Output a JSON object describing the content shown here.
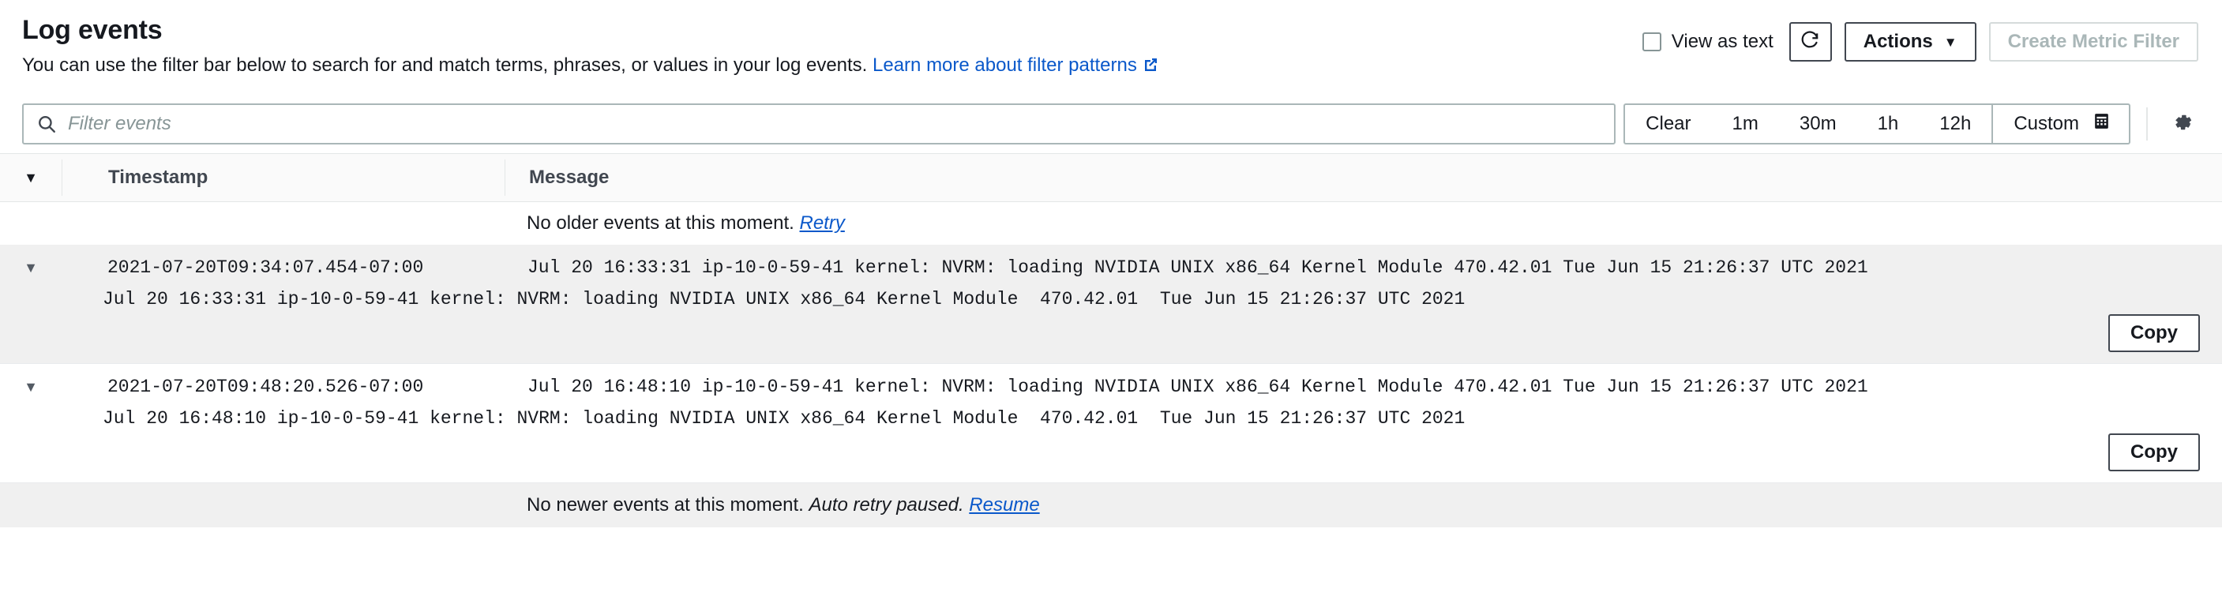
{
  "header": {
    "title": "Log events",
    "description_prefix": "You can use the filter bar below to search for and match terms, phrases, or values in your log events.",
    "description_link": "Learn more about filter patterns",
    "external_link_icon": "external-link-icon",
    "view_as_text_label": "View as text",
    "view_as_text_checked": false,
    "refresh_icon": "refresh-icon",
    "actions_label": "Actions",
    "actions_caret": "▼",
    "create_metric_filter_label": "Create Metric Filter",
    "create_metric_filter_disabled": true
  },
  "filter_bar": {
    "search_icon": "search-icon",
    "search_value": "",
    "search_placeholder": "Filter events",
    "ranges": [
      {
        "label": "Clear",
        "name": "clear"
      },
      {
        "label": "1m",
        "name": "1m"
      },
      {
        "label": "30m",
        "name": "30m"
      },
      {
        "label": "1h",
        "name": "1h"
      },
      {
        "label": "12h",
        "name": "12h"
      }
    ],
    "custom_label": "Custom",
    "calendar_icon": "calendar-icon",
    "settings_icon": "gear-icon"
  },
  "table": {
    "sort_caret": "▼",
    "columns": {
      "timestamp": "Timestamp",
      "message": "Message"
    },
    "older_note": "No older events at this moment.",
    "older_link": "Retry",
    "newer_note": "No newer events at this moment.",
    "newer_em": "Auto retry paused.",
    "newer_link": "Resume",
    "rows": [
      {
        "expand_caret": "▼",
        "timestamp": "2021-07-20T09:34:07.454-07:00",
        "message": "Jul 20 16:33:31 ip-10-0-59-41 kernel: NVRM: loading NVIDIA UNIX x86_64 Kernel Module 470.42.01 Tue Jun 15 21:26:37 UTC 2021",
        "detail": "Jul 20 16:33:31 ip-10-0-59-41 kernel: NVRM: loading NVIDIA UNIX x86_64 Kernel Module  470.42.01  Tue Jun 15 21:26:37 UTC 2021",
        "copy_label": "Copy",
        "expanded": true,
        "shaded": true
      },
      {
        "expand_caret": "▼",
        "timestamp": "2021-07-20T09:48:20.526-07:00",
        "message": "Jul 20 16:48:10 ip-10-0-59-41 kernel: NVRM: loading NVIDIA UNIX x86_64 Kernel Module 470.42.01 Tue Jun 15 21:26:37 UTC 2021",
        "detail": "Jul 20 16:48:10 ip-10-0-59-41 kernel: NVRM: loading NVIDIA UNIX x86_64 Kernel Module  470.42.01  Tue Jun 15 21:26:37 UTC 2021",
        "copy_label": "Copy",
        "expanded": true,
        "shaded": false
      }
    ]
  },
  "colors": {
    "link": "#0a58ca",
    "border": "#414750",
    "disabled": "#aab7b8",
    "row_shade": "#f0f0f0"
  }
}
